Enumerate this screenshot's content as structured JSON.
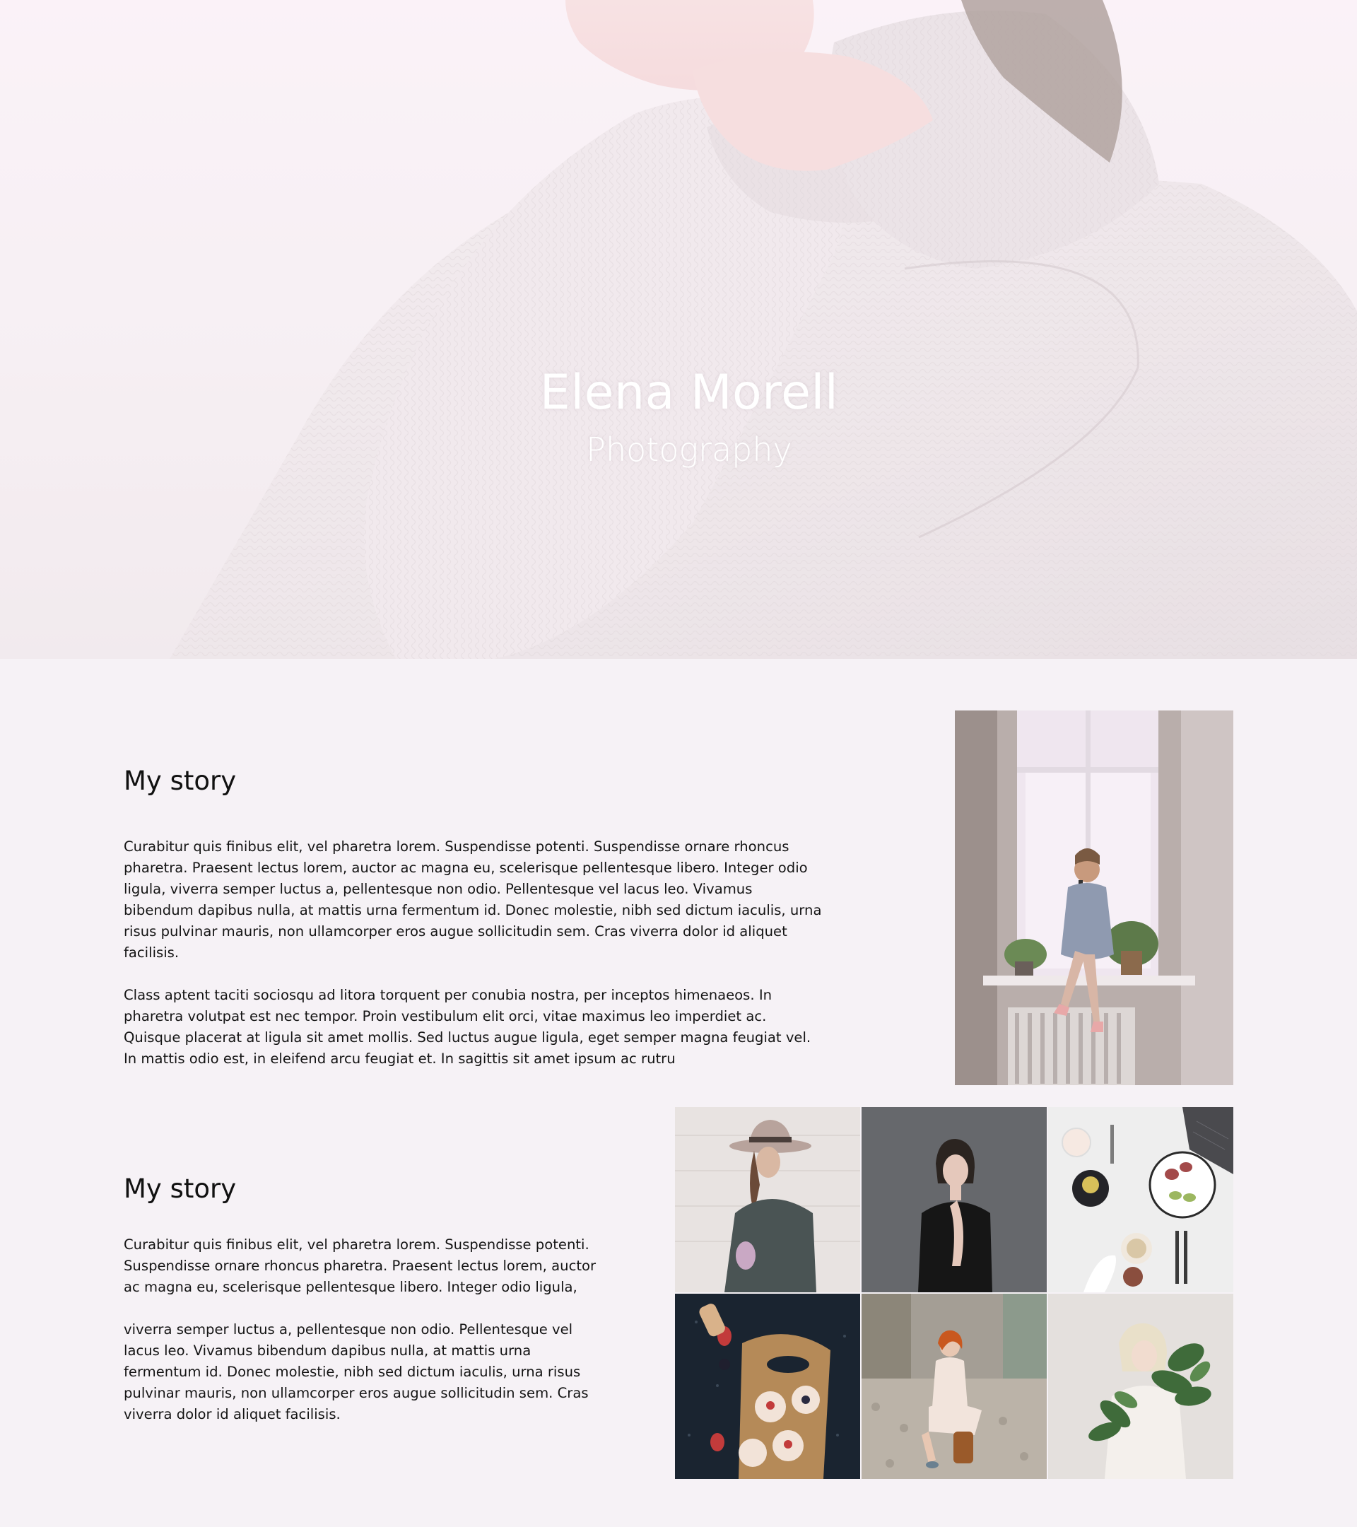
{
  "hero": {
    "title": "Elena Morell",
    "subtitle": "Photography",
    "image": "woman-in-knit-sweater-photo"
  },
  "story_primary": {
    "heading": "My story",
    "paragraphs": [
      "Curabitur quis finibus elit, vel pharetra lorem. Suspendisse potenti. Suspendisse ornare rhoncus pharetra. Praesent lectus lorem, auctor ac magna eu, scelerisque pellentesque libero. Integer odio ligula, viverra semper luctus a, pellentesque non odio. Pellentesque vel lacus leo. Vivamus bibendum dapibus nulla, at mattis urna fermentum id. Donec molestie, nibh sed dictum iaculis, urna risus pulvinar mauris, non ullamcorper eros augue sollicitudin sem. Cras viverra dolor id aliquet facilisis.",
      "Class aptent taciti sociosqu ad litora torquent per conubia nostra, per inceptos himenaeos. In pharetra volutpat est nec tempor. Proin vestibulum elit orci, vitae maximus leo imperdiet ac. Quisque placerat at ligula sit amet mollis. Sed luctus augue ligula, eget semper magna feugiat vel. In mattis odio est, in eleifend arcu feugiat et. In sagittis sit amet ipsum ac rutru"
    ],
    "image": "woman-photographing-on-windowsill-photo"
  },
  "story_secondary": {
    "heading": "My story",
    "paragraphs": [
      "Curabitur quis finibus elit, vel pharetra lorem. Suspendisse potenti. Suspendisse ornare rhoncus pharetra. Praesent lectus lorem, auctor ac magna eu, scelerisque pellentesque libero. Integer odio ligula,",
      "viverra semper luctus a, pellentesque non odio. Pellentesque vel lacus leo. Vivamus bibendum dapibus nulla, at mattis urna fermentum id. Donec molestie, nibh sed dictum iaculis, urna risus pulvinar mauris, non ullamcorper eros augue sollicitudin sem. Cras viverra dolor id aliquet facilisis."
    ]
  },
  "gallery": [
    "woman-in-hat-photo",
    "woman-in-black-top-photo",
    "breakfast-flatlay-photo",
    "cupcakes-on-board-photo",
    "redhead-woman-sitting-photo",
    "woman-with-leaves-photo"
  ],
  "colors": {
    "page_background": "#f6f2f6",
    "hero_text": "#ffffff",
    "body_text": "#141414"
  }
}
